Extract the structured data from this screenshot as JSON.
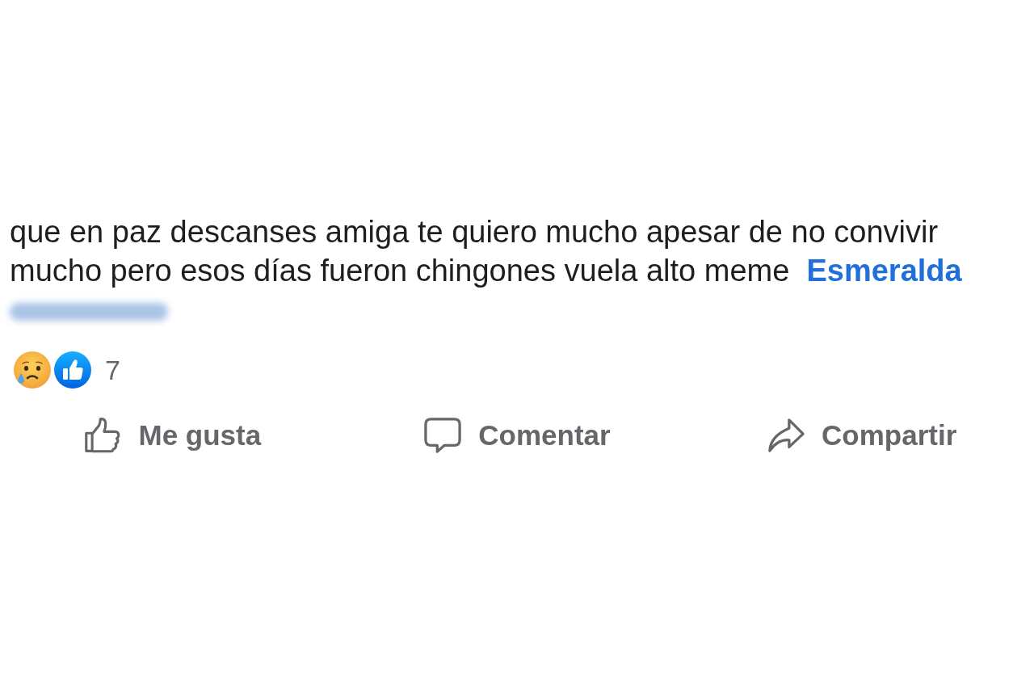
{
  "comment": {
    "text": "que en paz descanses amiga te quiero mucho apesar de no convivir mucho pero esos días fueron chingones vuela alto meme",
    "mention": "Esmeralda",
    "mention_blurred": true
  },
  "reactions": {
    "types": [
      {
        "kind": "sad"
      },
      {
        "kind": "like"
      }
    ],
    "count": "7"
  },
  "actions": [
    {
      "label": "Me gusta",
      "kind": "like"
    },
    {
      "label": "Comentar",
      "kind": "comment"
    },
    {
      "label": "Compartir",
      "kind": "share"
    }
  ]
}
